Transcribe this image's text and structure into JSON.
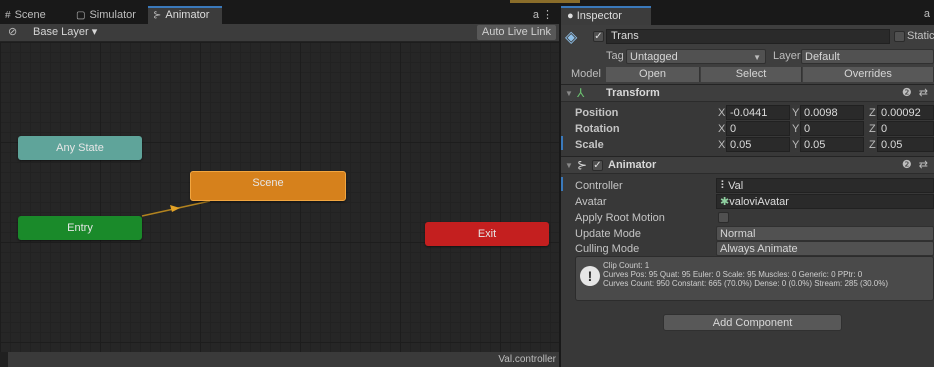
{
  "animator": {
    "tabs": [
      {
        "label": "Scene",
        "icon": "grid-icon"
      },
      {
        "label": "Simulator",
        "icon": "simulator-icon"
      },
      {
        "label": "Animator",
        "icon": "animator-icon"
      }
    ],
    "tab_menu_glyphs": "a ⋮",
    "layer": "Base Layer ▾",
    "auto_live_link": "Auto Live Link",
    "states": {
      "any_state": "Any State",
      "scene": "Scene",
      "entry": "Entry",
      "exit": "Exit"
    },
    "status_file": "Val.controller"
  },
  "inspector": {
    "tab": "Inspector",
    "object_name": "Trans",
    "static_label": "Static",
    "tag_label": "Tag",
    "tag_value": "Untagged",
    "layer_label": "Layer",
    "layer_value": "Default",
    "model_label": "Model",
    "model_buttons": [
      "Open",
      "Select",
      "Overrides"
    ],
    "transform": {
      "title": "Transform",
      "rows": [
        {
          "label": "Position",
          "x": "-0.0441",
          "y": "0.0098",
          "z": "0.00092"
        },
        {
          "label": "Rotation",
          "x": "0",
          "y": "0",
          "z": "0"
        },
        {
          "label": "Scale",
          "x": "0.05",
          "y": "0.05",
          "z": "0.05"
        }
      ]
    },
    "animator_comp": {
      "title": "Animator",
      "controller_label": "Controller",
      "controller_value": "Val",
      "avatar_label": "Avatar",
      "avatar_value": "valoviAvatar",
      "apply_root_motion_label": "Apply Root Motion",
      "update_mode_label": "Update Mode",
      "update_mode_value": "Normal",
      "culling_mode_label": "Culling Mode",
      "culling_mode_value": "Always Animate"
    },
    "info": {
      "line1": "Clip Count: 1",
      "line2": "Curves Pos: 95 Quat: 95 Euler: 0 Scale: 95 Muscles: 0 Generic: 0 PPtr: 0",
      "line3": "Curves Count: 950 Constant: 665 (70.0%) Dense: 0 (0.0%) Stream: 285 (30.0%)"
    },
    "add_component": "Add Component"
  },
  "colors": {
    "any_state": "#5fa49a",
    "scene": "#d6811c",
    "entry": "#1a8a2a",
    "exit": "#c41f1f",
    "accent": "#3a79bb"
  }
}
